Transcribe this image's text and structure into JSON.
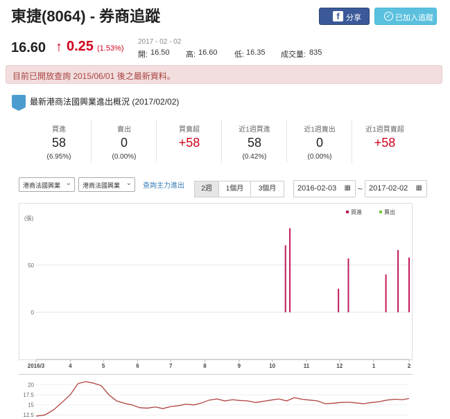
{
  "header": {
    "title": "東捷(8064) - 券商追蹤",
    "share_label": "分享",
    "share_icon": "facebook-icon",
    "follow_label": "已加入追蹤",
    "follow_icon": "check-circle-icon"
  },
  "quote": {
    "price": "16.60",
    "arrow": "↑",
    "change": "0.25",
    "change_pct": "(1.53%)",
    "date": "2017 - 02 - 02",
    "open_label": "開:",
    "open": "16.50",
    "high_label": "高:",
    "high": "16.60",
    "low_label": "低:",
    "low": "16.35",
    "volume_label": "成交量:",
    "volume": "835",
    "up_color": "#d0021b"
  },
  "alert": {
    "text": "目前已開放查詢 2015/06/01 後之最新資料。"
  },
  "section": {
    "title": "最新港商法國興業進出概況 (2017/02/02)"
  },
  "stats": [
    {
      "label": "買進",
      "value": "58",
      "sub": "(6.95%)"
    },
    {
      "label": "賣出",
      "value": "0",
      "sub": "(0.00%)"
    },
    {
      "label": "買賣超",
      "value": "+58",
      "sub": ""
    },
    {
      "label": "近1週買進",
      "value": "58",
      "sub": "(0.42%)"
    },
    {
      "label": "近1週賣出",
      "value": "0",
      "sub": "(0.00%)"
    },
    {
      "label": "近1週買賣超",
      "value": "+58",
      "sub": ""
    }
  ],
  "controls": {
    "broker1": "港商法國興業",
    "broker2": "港商法國興業",
    "query_link": "查詢主力進出",
    "ranges": [
      "2週",
      "1個月",
      "3個月"
    ],
    "date_from": "2016-02-03",
    "date_to": "2017-02-02",
    "tilde": "~"
  },
  "chart_data": [
    {
      "type": "bar",
      "ylabel": "(張)",
      "yticks": [
        0,
        50
      ],
      "ylim": [
        -50,
        110
      ],
      "xticks": [
        "2016/3",
        "4",
        "5",
        "6",
        "7",
        "8",
        "9",
        "10",
        "11",
        "12",
        "1",
        "2"
      ],
      "xtick_dates": [
        "2016-03-01",
        "2016-04-01",
        "2016-05-01",
        "2016-06-01",
        "2016-07-01",
        "2016-08-01",
        "2016-09-01",
        "2016-10-01",
        "2016-11-01",
        "2016-12-01",
        "2017-01-01",
        "2017-02-02"
      ],
      "legend_position": "top-right",
      "grid": true,
      "series": [
        {
          "name": "買進",
          "color": "#c2185b",
          "points": [
            [
              "2016-10-13",
              71
            ],
            [
              "2016-10-17",
              89
            ],
            [
              "2016-11-30",
              25
            ],
            [
              "2016-12-09",
              57
            ],
            [
              "2017-01-12",
              40
            ],
            [
              "2017-01-23",
              66
            ],
            [
              "2017-02-02",
              58
            ]
          ]
        },
        {
          "name": "賣出",
          "color": "#7ac943",
          "points": []
        }
      ]
    },
    {
      "type": "line",
      "yticks": [
        12.5,
        15,
        17.5,
        20
      ],
      "ylim": [
        11.5,
        22
      ],
      "color": "#b0413e",
      "series": [
        {
          "points": [
            [
              "2016-03-01",
              12.2
            ],
            [
              "2016-03-09",
              12.5
            ],
            [
              "2016-03-17",
              13.8
            ],
            [
              "2016-03-24",
              15.5
            ],
            [
              "2016-04-01",
              17.5
            ],
            [
              "2016-04-08",
              20.3
            ],
            [
              "2016-04-15",
              20.8
            ],
            [
              "2016-04-22",
              20.4
            ],
            [
              "2016-04-29",
              19.8
            ],
            [
              "2016-05-06",
              17.5
            ],
            [
              "2016-05-13",
              16.0
            ],
            [
              "2016-05-20",
              15.4
            ],
            [
              "2016-05-27",
              15.0
            ],
            [
              "2016-06-03",
              14.3
            ],
            [
              "2016-06-10",
              14.2
            ],
            [
              "2016-06-17",
              14.5
            ],
            [
              "2016-06-24",
              14.1
            ],
            [
              "2016-07-01",
              14.6
            ],
            [
              "2016-07-08",
              14.8
            ],
            [
              "2016-07-15",
              15.2
            ],
            [
              "2016-07-22",
              15.0
            ],
            [
              "2016-07-29",
              15.5
            ],
            [
              "2016-08-05",
              16.2
            ],
            [
              "2016-08-12",
              16.5
            ],
            [
              "2016-08-19",
              16.0
            ],
            [
              "2016-08-26",
              16.3
            ],
            [
              "2016-09-02",
              16.1
            ],
            [
              "2016-09-09",
              16.0
            ],
            [
              "2016-09-16",
              15.6
            ],
            [
              "2016-09-23",
              15.9
            ],
            [
              "2016-09-30",
              16.2
            ],
            [
              "2016-10-07",
              16.5
            ],
            [
              "2016-10-14",
              16.0
            ],
            [
              "2016-10-21",
              16.8
            ],
            [
              "2016-10-28",
              16.4
            ],
            [
              "2016-11-04",
              16.2
            ],
            [
              "2016-11-11",
              16.0
            ],
            [
              "2016-11-18",
              15.3
            ],
            [
              "2016-11-25",
              15.4
            ],
            [
              "2016-12-02",
              15.6
            ],
            [
              "2016-12-09",
              15.7
            ],
            [
              "2016-12-16",
              15.5
            ],
            [
              "2016-12-23",
              15.3
            ],
            [
              "2016-12-30",
              15.6
            ],
            [
              "2017-01-06",
              15.8
            ],
            [
              "2017-01-13",
              16.2
            ],
            [
              "2017-01-20",
              16.4
            ],
            [
              "2017-01-27",
              16.3
            ],
            [
              "2017-02-02",
              16.6
            ]
          ]
        }
      ]
    }
  ]
}
